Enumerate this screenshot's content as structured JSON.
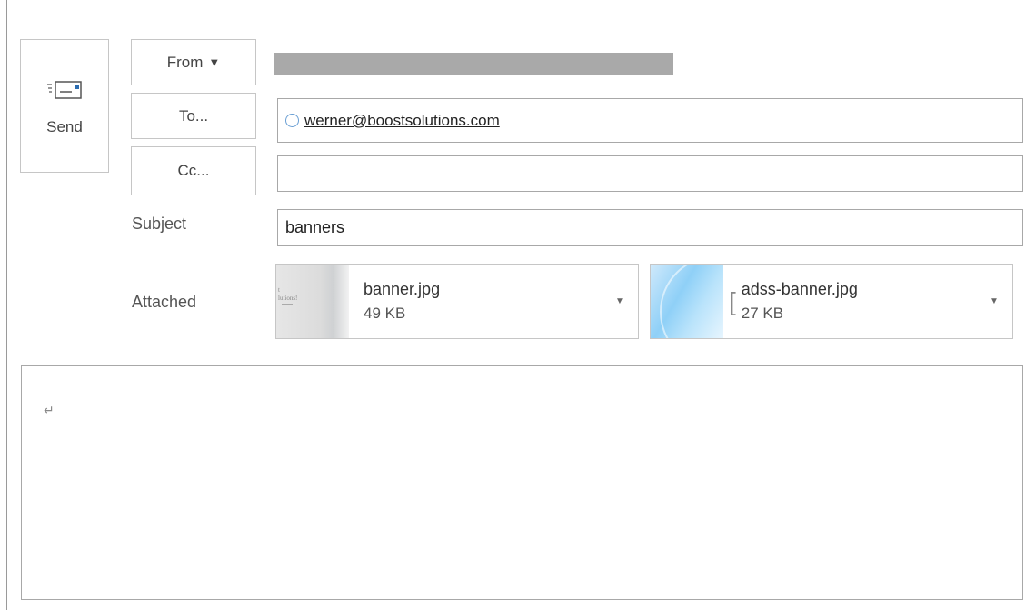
{
  "compose": {
    "send_label": "Send",
    "from_label": "From",
    "to_label": "To...",
    "cc_label": "Cc...",
    "subject_label": "Subject",
    "attached_label": "Attached",
    "to_value": "werner@boostsolutions.com",
    "cc_value": "",
    "subject_value": "banners",
    "body_mark": "↵"
  },
  "attachments": [
    {
      "name": "banner.jpg",
      "size": "49 KB",
      "thumb_text": "t\nlutions!"
    },
    {
      "name": "adss-banner.jpg",
      "size": "27 KB"
    }
  ],
  "icons": {
    "send": "envelope-send-icon",
    "from_caret": "caret-down-icon",
    "attachment_menu": "triangle-down-icon"
  },
  "colors": {
    "border": "#c6c6c6",
    "field_border": "#a8a8a8",
    "redacted_bar": "#a9a9a9",
    "recipient_circle": "#6a9fd4"
  }
}
